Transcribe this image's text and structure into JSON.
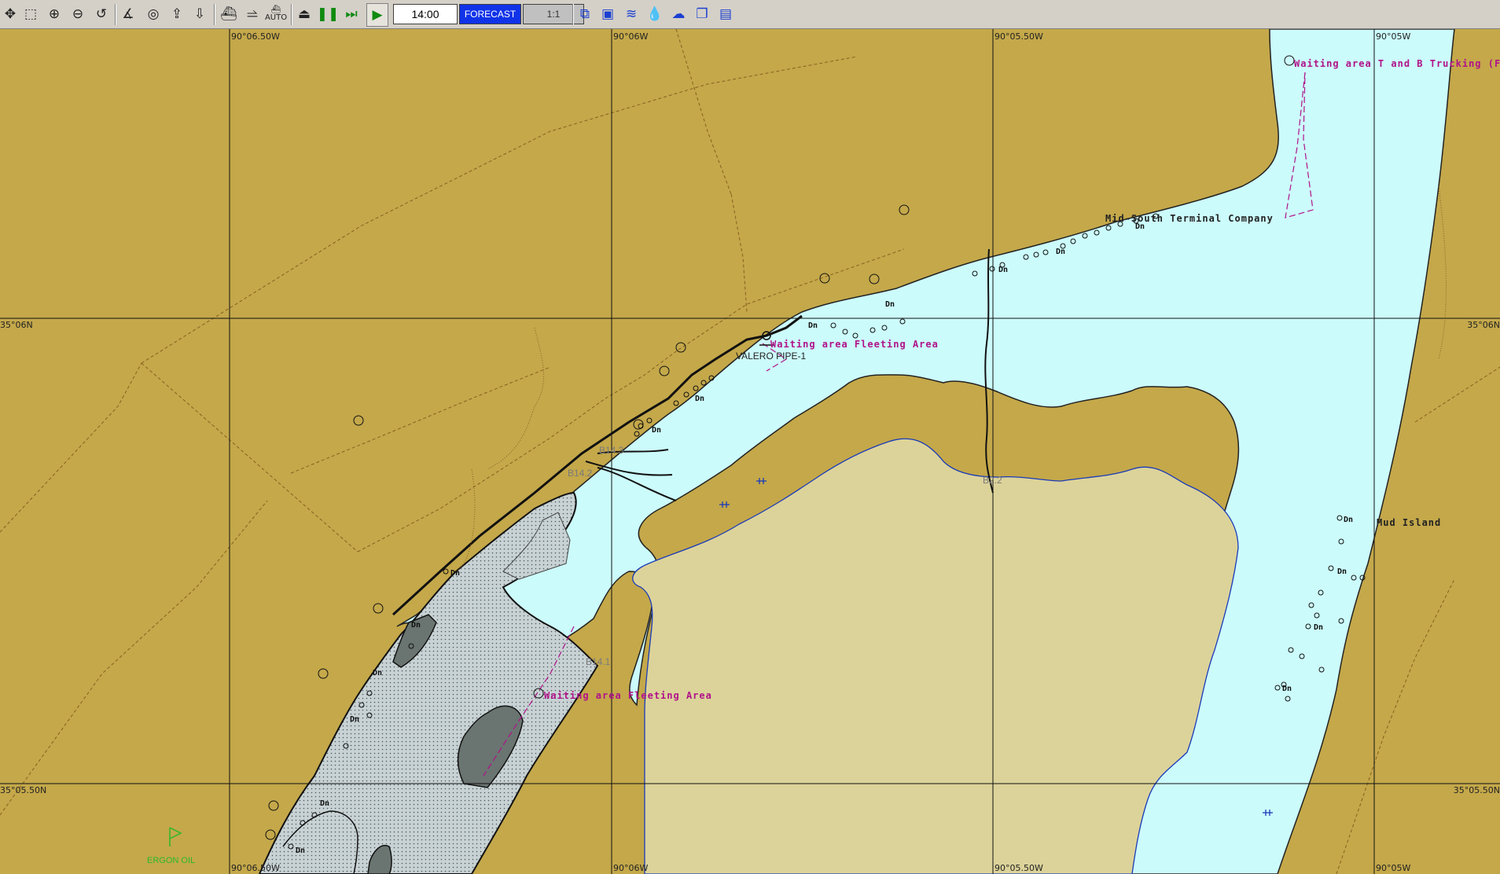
{
  "toolbar": {
    "time": "14:00",
    "forecast_label": "FORECAST",
    "scale": "1:1",
    "auto_label": "AUTO",
    "icons": [
      "pan-icon",
      "zoom-box-icon",
      "zoom-in-icon",
      "zoom-out-icon",
      "undo-view-icon",
      "measure-icon",
      "target-icon",
      "export-icon",
      "import-icon",
      "ship-icon",
      "route-icon",
      "auto-ship-icon",
      "stop-icon",
      "pause-icon",
      "fast-forward-icon",
      "play-icon",
      "layers-icon",
      "chart-settings-icon",
      "current-icon",
      "depth-icon",
      "weather-icon",
      "copy-icon",
      "window-icon"
    ]
  },
  "grid": {
    "top_longitudes": [
      "90°06.50W",
      "90°06W",
      "90°05.50W",
      "90°05W"
    ],
    "bottom_longitudes": [
      "90°06.50W",
      "90°06W",
      "90°05.50W",
      "90°05W"
    ],
    "left_latitudes": [
      "35°06N",
      "35°05.50N"
    ],
    "right_latitudes": [
      "35°06N",
      "35°05.50N"
    ]
  },
  "labels": {
    "waiting_area_1": "Waiting area T and B Trucking (Fl",
    "mid_south": "Mid-South Terminal Company",
    "waiting_area_2": "Waiting area Fleeting Area",
    "valero": "VALERO PIPE-1",
    "mud_island": "Mud Island",
    "waiting_area_3": "Waiting area Fleeting Area",
    "ergon": "ERGON OIL",
    "b14_3": "B14.3",
    "b14_2": "B14.2",
    "b14_1": "B14.1",
    "b2_2": "B2.2",
    "dn": "Dn"
  },
  "colors": {
    "land": "#c4a84a",
    "water": "#ccfbfb",
    "sand": "#dcd39a",
    "marsh": "#c8d2d4",
    "rock": "#6a7470",
    "magenta": "#b0128a",
    "toolbar": "#d4d0c8",
    "forecast": "#1133e8"
  }
}
